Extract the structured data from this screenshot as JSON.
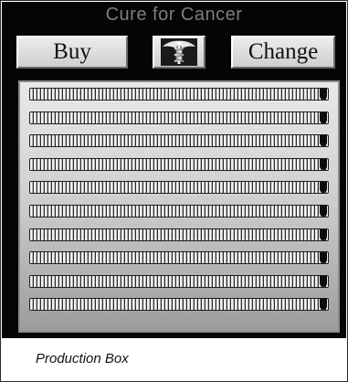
{
  "title": "Cure for Cancer",
  "buttons": {
    "buy_label": "Buy",
    "change_label": "Change",
    "icon": "caduceus-icon"
  },
  "production_slots": [
    {
      "filled": true
    },
    {
      "filled": true
    },
    {
      "filled": true
    },
    {
      "filled": true
    },
    {
      "filled": true
    },
    {
      "filled": true
    },
    {
      "filled": true
    },
    {
      "filled": true
    },
    {
      "filled": true
    },
    {
      "filled": true
    }
  ],
  "caption": "Production Box",
  "colors": {
    "panel_background": "#050505",
    "title_text": "#7d7d7d",
    "button_face": "#dedede"
  }
}
